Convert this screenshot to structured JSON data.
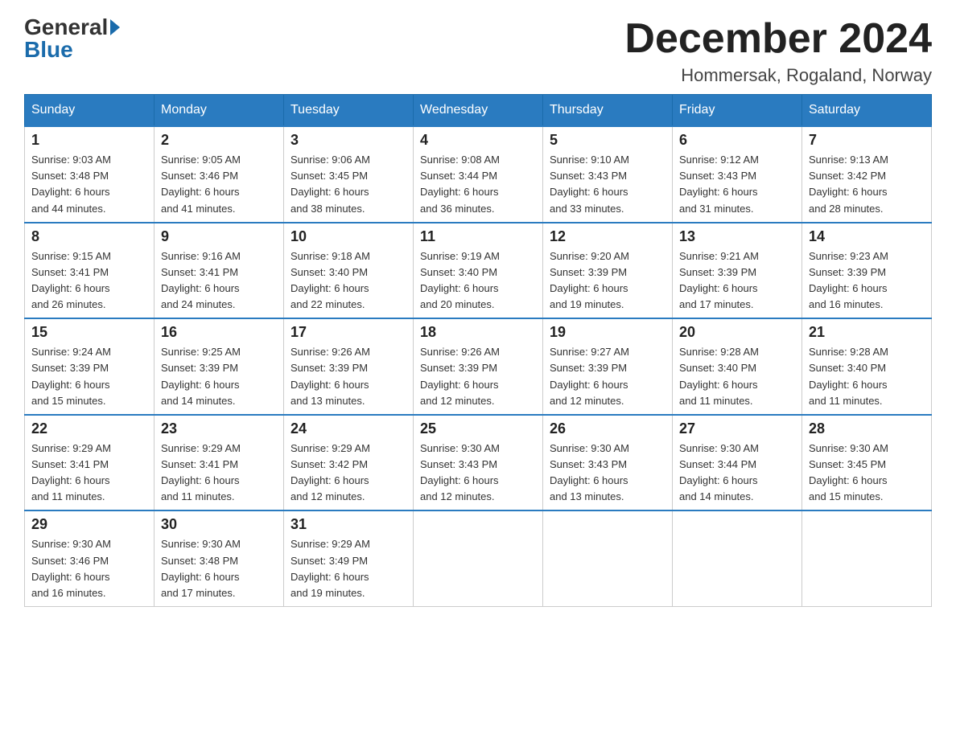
{
  "logo": {
    "general": "General",
    "blue": "Blue",
    "arrow": true
  },
  "title": {
    "month_year": "December 2024",
    "location": "Hommersak, Rogaland, Norway"
  },
  "weekdays": [
    "Sunday",
    "Monday",
    "Tuesday",
    "Wednesday",
    "Thursday",
    "Friday",
    "Saturday"
  ],
  "weeks": [
    [
      {
        "day": "1",
        "sunrise": "Sunrise: 9:03 AM",
        "sunset": "Sunset: 3:48 PM",
        "daylight": "Daylight: 6 hours",
        "minutes": "and 44 minutes."
      },
      {
        "day": "2",
        "sunrise": "Sunrise: 9:05 AM",
        "sunset": "Sunset: 3:46 PM",
        "daylight": "Daylight: 6 hours",
        "minutes": "and 41 minutes."
      },
      {
        "day": "3",
        "sunrise": "Sunrise: 9:06 AM",
        "sunset": "Sunset: 3:45 PM",
        "daylight": "Daylight: 6 hours",
        "minutes": "and 38 minutes."
      },
      {
        "day": "4",
        "sunrise": "Sunrise: 9:08 AM",
        "sunset": "Sunset: 3:44 PM",
        "daylight": "Daylight: 6 hours",
        "minutes": "and 36 minutes."
      },
      {
        "day": "5",
        "sunrise": "Sunrise: 9:10 AM",
        "sunset": "Sunset: 3:43 PM",
        "daylight": "Daylight: 6 hours",
        "minutes": "and 33 minutes."
      },
      {
        "day": "6",
        "sunrise": "Sunrise: 9:12 AM",
        "sunset": "Sunset: 3:43 PM",
        "daylight": "Daylight: 6 hours",
        "minutes": "and 31 minutes."
      },
      {
        "day": "7",
        "sunrise": "Sunrise: 9:13 AM",
        "sunset": "Sunset: 3:42 PM",
        "daylight": "Daylight: 6 hours",
        "minutes": "and 28 minutes."
      }
    ],
    [
      {
        "day": "8",
        "sunrise": "Sunrise: 9:15 AM",
        "sunset": "Sunset: 3:41 PM",
        "daylight": "Daylight: 6 hours",
        "minutes": "and 26 minutes."
      },
      {
        "day": "9",
        "sunrise": "Sunrise: 9:16 AM",
        "sunset": "Sunset: 3:41 PM",
        "daylight": "Daylight: 6 hours",
        "minutes": "and 24 minutes."
      },
      {
        "day": "10",
        "sunrise": "Sunrise: 9:18 AM",
        "sunset": "Sunset: 3:40 PM",
        "daylight": "Daylight: 6 hours",
        "minutes": "and 22 minutes."
      },
      {
        "day": "11",
        "sunrise": "Sunrise: 9:19 AM",
        "sunset": "Sunset: 3:40 PM",
        "daylight": "Daylight: 6 hours",
        "minutes": "and 20 minutes."
      },
      {
        "day": "12",
        "sunrise": "Sunrise: 9:20 AM",
        "sunset": "Sunset: 3:39 PM",
        "daylight": "Daylight: 6 hours",
        "minutes": "and 19 minutes."
      },
      {
        "day": "13",
        "sunrise": "Sunrise: 9:21 AM",
        "sunset": "Sunset: 3:39 PM",
        "daylight": "Daylight: 6 hours",
        "minutes": "and 17 minutes."
      },
      {
        "day": "14",
        "sunrise": "Sunrise: 9:23 AM",
        "sunset": "Sunset: 3:39 PM",
        "daylight": "Daylight: 6 hours",
        "minutes": "and 16 minutes."
      }
    ],
    [
      {
        "day": "15",
        "sunrise": "Sunrise: 9:24 AM",
        "sunset": "Sunset: 3:39 PM",
        "daylight": "Daylight: 6 hours",
        "minutes": "and 15 minutes."
      },
      {
        "day": "16",
        "sunrise": "Sunrise: 9:25 AM",
        "sunset": "Sunset: 3:39 PM",
        "daylight": "Daylight: 6 hours",
        "minutes": "and 14 minutes."
      },
      {
        "day": "17",
        "sunrise": "Sunrise: 9:26 AM",
        "sunset": "Sunset: 3:39 PM",
        "daylight": "Daylight: 6 hours",
        "minutes": "and 13 minutes."
      },
      {
        "day": "18",
        "sunrise": "Sunrise: 9:26 AM",
        "sunset": "Sunset: 3:39 PM",
        "daylight": "Daylight: 6 hours",
        "minutes": "and 12 minutes."
      },
      {
        "day": "19",
        "sunrise": "Sunrise: 9:27 AM",
        "sunset": "Sunset: 3:39 PM",
        "daylight": "Daylight: 6 hours",
        "minutes": "and 12 minutes."
      },
      {
        "day": "20",
        "sunrise": "Sunrise: 9:28 AM",
        "sunset": "Sunset: 3:40 PM",
        "daylight": "Daylight: 6 hours",
        "minutes": "and 11 minutes."
      },
      {
        "day": "21",
        "sunrise": "Sunrise: 9:28 AM",
        "sunset": "Sunset: 3:40 PM",
        "daylight": "Daylight: 6 hours",
        "minutes": "and 11 minutes."
      }
    ],
    [
      {
        "day": "22",
        "sunrise": "Sunrise: 9:29 AM",
        "sunset": "Sunset: 3:41 PM",
        "daylight": "Daylight: 6 hours",
        "minutes": "and 11 minutes."
      },
      {
        "day": "23",
        "sunrise": "Sunrise: 9:29 AM",
        "sunset": "Sunset: 3:41 PM",
        "daylight": "Daylight: 6 hours",
        "minutes": "and 11 minutes."
      },
      {
        "day": "24",
        "sunrise": "Sunrise: 9:29 AM",
        "sunset": "Sunset: 3:42 PM",
        "daylight": "Daylight: 6 hours",
        "minutes": "and 12 minutes."
      },
      {
        "day": "25",
        "sunrise": "Sunrise: 9:30 AM",
        "sunset": "Sunset: 3:43 PM",
        "daylight": "Daylight: 6 hours",
        "minutes": "and 12 minutes."
      },
      {
        "day": "26",
        "sunrise": "Sunrise: 9:30 AM",
        "sunset": "Sunset: 3:43 PM",
        "daylight": "Daylight: 6 hours",
        "minutes": "and 13 minutes."
      },
      {
        "day": "27",
        "sunrise": "Sunrise: 9:30 AM",
        "sunset": "Sunset: 3:44 PM",
        "daylight": "Daylight: 6 hours",
        "minutes": "and 14 minutes."
      },
      {
        "day": "28",
        "sunrise": "Sunrise: 9:30 AM",
        "sunset": "Sunset: 3:45 PM",
        "daylight": "Daylight: 6 hours",
        "minutes": "and 15 minutes."
      }
    ],
    [
      {
        "day": "29",
        "sunrise": "Sunrise: 9:30 AM",
        "sunset": "Sunset: 3:46 PM",
        "daylight": "Daylight: 6 hours",
        "minutes": "and 16 minutes."
      },
      {
        "day": "30",
        "sunrise": "Sunrise: 9:30 AM",
        "sunset": "Sunset: 3:48 PM",
        "daylight": "Daylight: 6 hours",
        "minutes": "and 17 minutes."
      },
      {
        "day": "31",
        "sunrise": "Sunrise: 9:29 AM",
        "sunset": "Sunset: 3:49 PM",
        "daylight": "Daylight: 6 hours",
        "minutes": "and 19 minutes."
      },
      null,
      null,
      null,
      null
    ]
  ]
}
